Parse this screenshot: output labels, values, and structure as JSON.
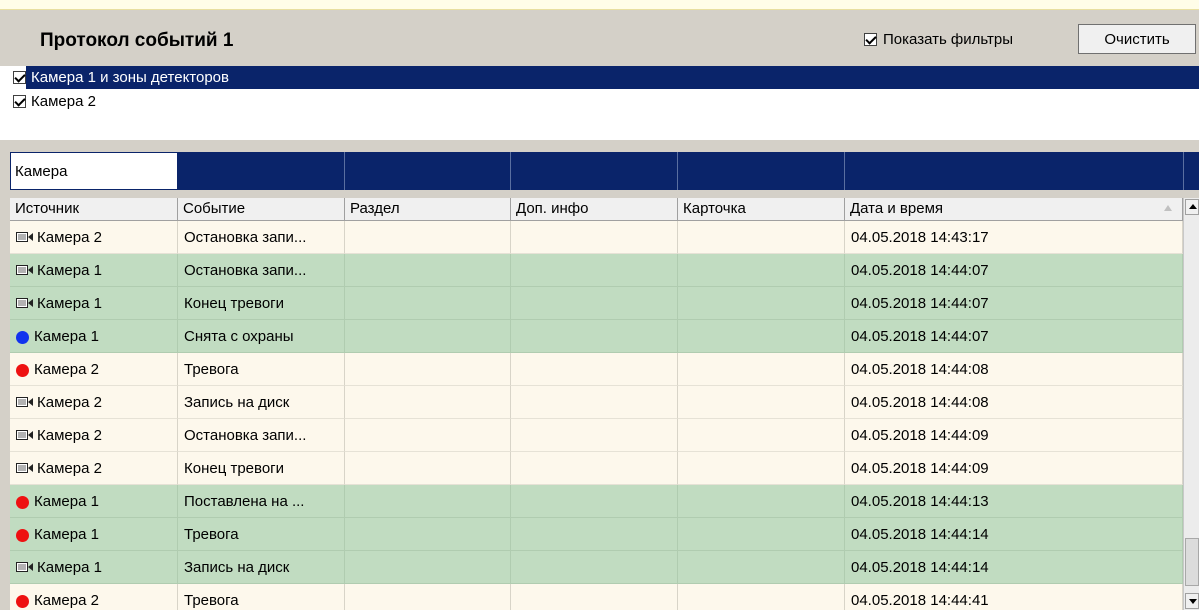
{
  "header": {
    "title": "Протокол событий 1",
    "show_filters_label": "Показать фильтры",
    "show_filters_checked": true,
    "clear_label": "Очистить"
  },
  "filters": [
    {
      "label": "Камера 1 и зоны детекторов",
      "checked": true,
      "selected": true
    },
    {
      "label": "Камера 2",
      "checked": true,
      "selected": false
    }
  ],
  "filter_bar": {
    "camera_value": "Камера"
  },
  "columns": [
    "Источник",
    "Событие",
    "Раздел",
    "Доп. инфо",
    "Карточка",
    "Дата и время"
  ],
  "rows": [
    {
      "icon": "camera-icon",
      "source": "Камера 2",
      "event": "Остановка запи...",
      "section": "",
      "info": "",
      "card": "",
      "datetime": "04.05.2018 14:43:17",
      "bg": "beige"
    },
    {
      "icon": "camera-icon",
      "source": "Камера 1",
      "event": "Остановка запи...",
      "section": "",
      "info": "",
      "card": "",
      "datetime": "04.05.2018 14:44:07",
      "bg": "green"
    },
    {
      "icon": "camera-icon",
      "source": "Камера 1",
      "event": "Конец тревоги",
      "section": "",
      "info": "",
      "card": "",
      "datetime": "04.05.2018 14:44:07",
      "bg": "green"
    },
    {
      "icon": "blue-dot-icon",
      "source": "Камера 1",
      "event": "Снята с охраны",
      "section": "",
      "info": "",
      "card": "",
      "datetime": "04.05.2018 14:44:07",
      "bg": "green"
    },
    {
      "icon": "red-dot-icon",
      "source": "Камера 2",
      "event": "Тревога",
      "section": "",
      "info": "",
      "card": "",
      "datetime": "04.05.2018 14:44:08",
      "bg": "beige"
    },
    {
      "icon": "camera-icon",
      "source": "Камера 2",
      "event": "Запись на диск",
      "section": "",
      "info": "",
      "card": "",
      "datetime": "04.05.2018 14:44:08",
      "bg": "beige"
    },
    {
      "icon": "camera-icon",
      "source": "Камера 2",
      "event": "Остановка запи...",
      "section": "",
      "info": "",
      "card": "",
      "datetime": "04.05.2018 14:44:09",
      "bg": "beige"
    },
    {
      "icon": "camera-icon",
      "source": "Камера 2",
      "event": "Конец тревоги",
      "section": "",
      "info": "",
      "card": "",
      "datetime": "04.05.2018 14:44:09",
      "bg": "beige"
    },
    {
      "icon": "red-dot-icon",
      "source": "Камера 1",
      "event": "Поставлена на ...",
      "section": "",
      "info": "",
      "card": "",
      "datetime": "04.05.2018 14:44:13",
      "bg": "green"
    },
    {
      "icon": "red-dot-icon",
      "source": "Камера 1",
      "event": "Тревога",
      "section": "",
      "info": "",
      "card": "",
      "datetime": "04.05.2018 14:44:14",
      "bg": "green"
    },
    {
      "icon": "camera-icon",
      "source": "Камера 1",
      "event": "Запись на диск",
      "section": "",
      "info": "",
      "card": "",
      "datetime": "04.05.2018 14:44:14",
      "bg": "green"
    },
    {
      "icon": "red-dot-icon",
      "source": "Камера 2",
      "event": "Тревога",
      "section": "",
      "info": "",
      "card": "",
      "datetime": "04.05.2018 14:44:41",
      "bg": "beige"
    }
  ],
  "colors": {
    "selection": "#0a246a",
    "row_beige": "#fdf8ec",
    "row_green": "#c1dcc1",
    "dot_red": "#ee1111",
    "dot_blue": "#1133ee"
  }
}
